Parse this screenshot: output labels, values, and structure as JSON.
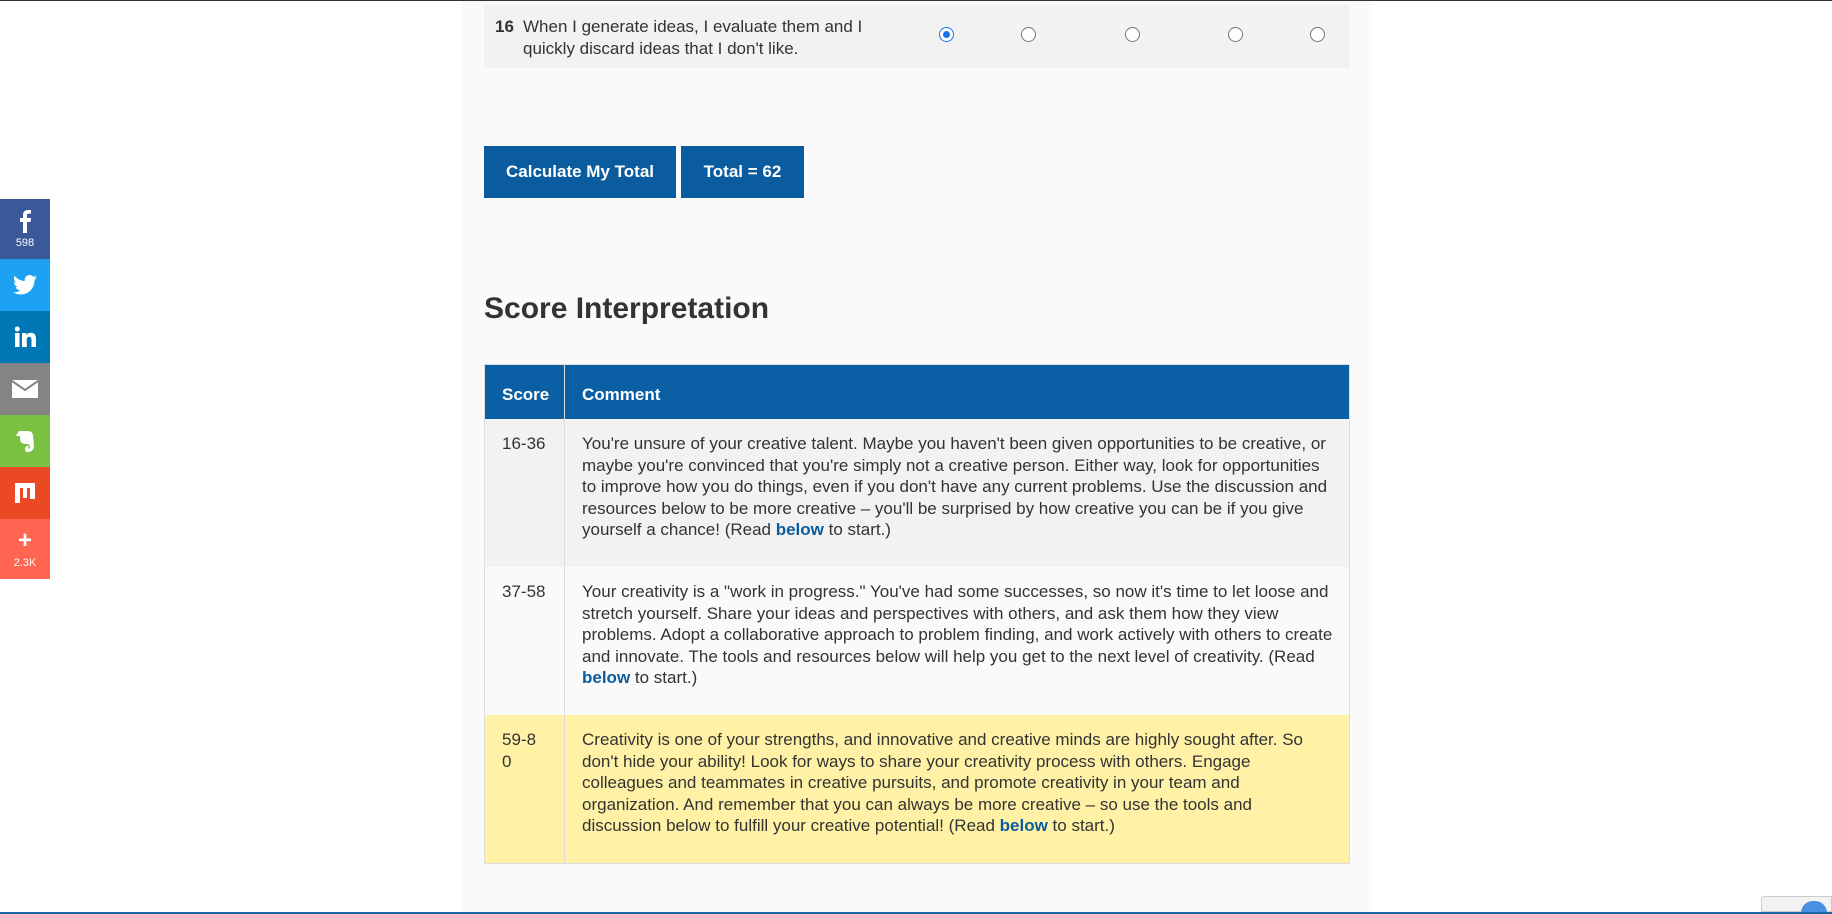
{
  "question": {
    "number": "16",
    "text": "When I generate ideas, I evaluate them and I quickly discard ideas that I don't like.",
    "selected_option": 1,
    "option_count": 5
  },
  "buttons": {
    "calculate_label": "Calculate My Total",
    "total_label": "Total = 62"
  },
  "interpretation": {
    "title": "Score Interpretation",
    "headers": {
      "score": "Score",
      "comment": "Comment"
    },
    "rows": [
      {
        "score": "16-36",
        "comment_before": "You're unsure of your creative talent. Maybe you haven't been given opportunities to be creative, or maybe you're convinced that you're simply not a creative person. Either way, look for opportunities to improve how you do things, even if you don't have any current problems. Use the discussion and resources below to be more creative – you'll be surprised by how creative you can be if you give yourself a chance! (Read ",
        "link": "below",
        "comment_after": " to start.)"
      },
      {
        "score": "37-58",
        "comment_before": "Your creativity is a \"work in progress.\" You've had some successes, so now it's time to let loose and stretch yourself. Share your ideas and perspectives with others, and ask them how they view problems. Adopt a collaborative approach to problem finding, and work actively with others to create and innovate. The tools and resources below will help you get to the next level of creativity. (Read ",
        "link": "below",
        "comment_after": " to start.)"
      },
      {
        "score": "59-80",
        "comment_before": "Creativity is one of your strengths, and innovative and creative minds are highly sought after. So don't hide your ability! Look for ways to share your creativity process with others. Engage colleagues and teammates in creative pursuits, and promote creativity in your team and organization. And remember that you can always be more creative – so use the tools and discussion below to fulfill your creative potential! (Read ",
        "link": "below",
        "comment_after": " to start.)"
      }
    ]
  },
  "share_bar": {
    "facebook_count": "598",
    "more_count": "2.3K",
    "icons": [
      "facebook-icon",
      "twitter-icon",
      "linkedin-icon",
      "email-icon",
      "evernote-icon",
      "mix-icon",
      "plus-icon"
    ]
  },
  "colors": {
    "primary": "#0b5c9e",
    "header": "#0b60a5",
    "highlight_row": "#fff2a6",
    "link": "#0b5c9e"
  }
}
